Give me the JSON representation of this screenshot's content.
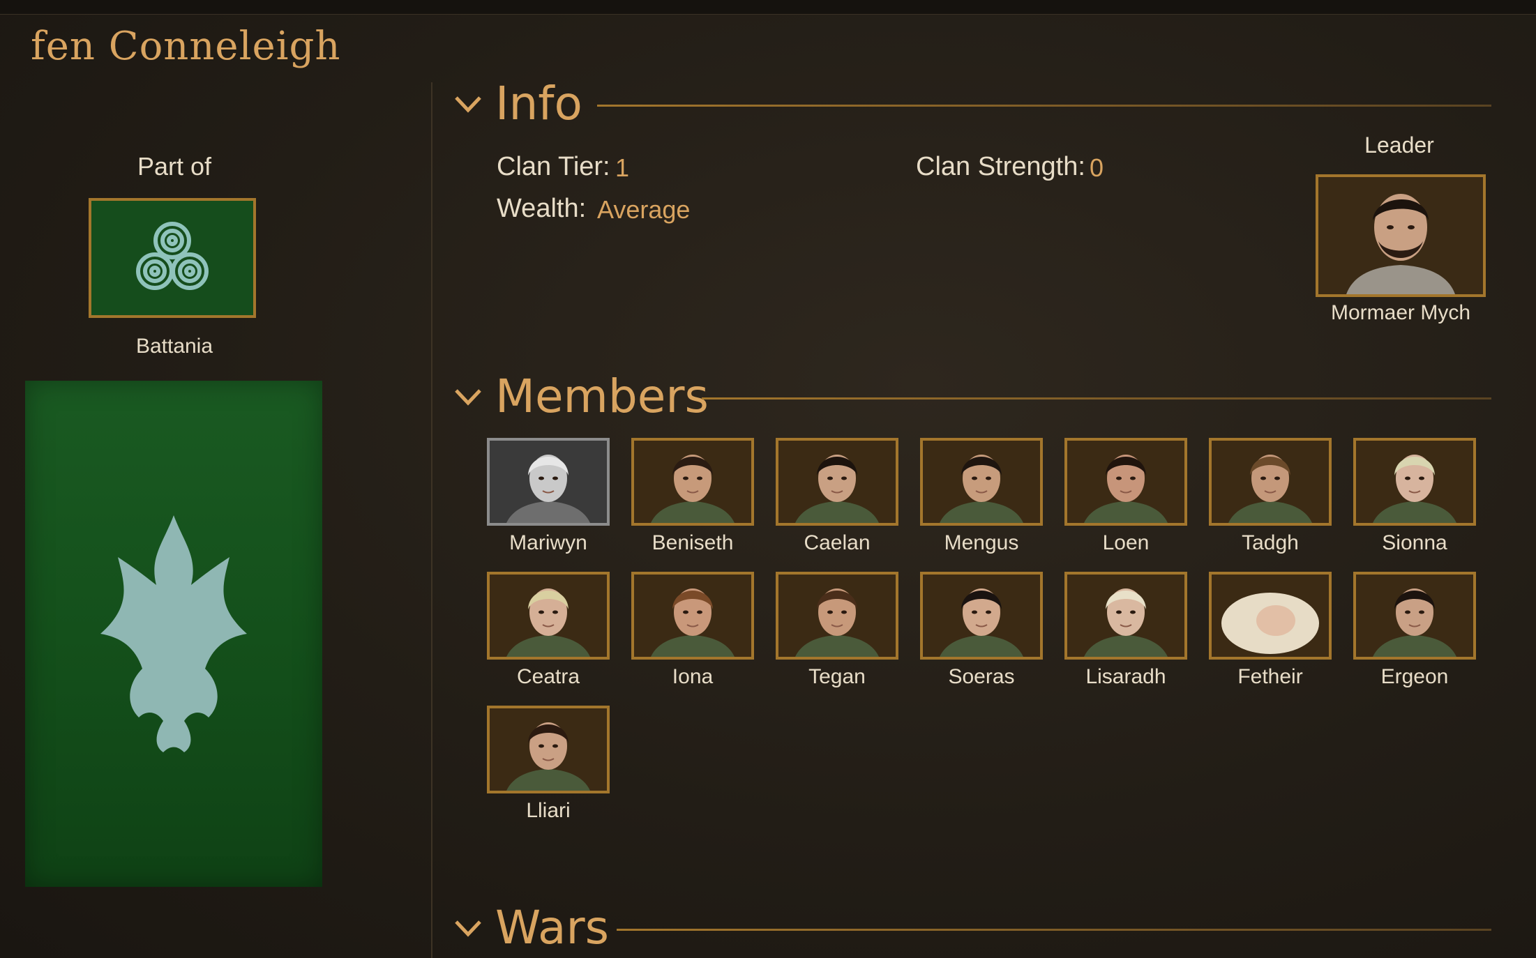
{
  "clan": {
    "name": "fen Conneleigh"
  },
  "kingdom": {
    "part_of_label": "Part of",
    "name": "Battania",
    "banner_color": "#154d1c",
    "symbol_color": "#8fc3bb"
  },
  "clan_banner": {
    "color": "#14501b",
    "symbol_color": "#8fb7b3"
  },
  "colors": {
    "accent": "#d9a460",
    "frame": "#a3762c",
    "text": "#e8ddc8"
  },
  "sections": {
    "info": {
      "title": "Info"
    },
    "members": {
      "title": "Members"
    },
    "wars": {
      "title": "Wars"
    }
  },
  "info": {
    "clan_tier_label": "Clan Tier:",
    "clan_tier_value": "1",
    "clan_strength_label": "Clan Strength:",
    "clan_strength_value": "0",
    "wealth_label": "Wealth:",
    "wealth_value": "Average"
  },
  "leader": {
    "label": "Leader",
    "name": "Mormaer Mych"
  },
  "members": [
    {
      "name": "Mariwyn",
      "skin": "#c9c9c9",
      "hair": "#e6e6e6",
      "grey": true
    },
    {
      "name": "Beniseth",
      "skin": "#c79a7a",
      "hair": "#2a1b12"
    },
    {
      "name": "Caelan",
      "skin": "#c9a083",
      "hair": "#1c130d"
    },
    {
      "name": "Mengus",
      "skin": "#c79c7c",
      "hair": "#1e150f"
    },
    {
      "name": "Loen",
      "skin": "#c7957a",
      "hair": "#20140d"
    },
    {
      "name": "Tadgh",
      "skin": "#c4987a",
      "hair": "#6b4a2a"
    },
    {
      "name": "Sionna",
      "skin": "#d7b49e",
      "hair": "#d8d5b0"
    },
    {
      "name": "Ceatra",
      "skin": "#d5af96",
      "hair": "#d9cfa0"
    },
    {
      "name": "Iona",
      "skin": "#c9987a",
      "hair": "#7a4a28"
    },
    {
      "name": "Tegan",
      "skin": "#c7997a",
      "hair": "#4a2e1a"
    },
    {
      "name": "Soeras",
      "skin": "#d2a98d",
      "hair": "#1a1310"
    },
    {
      "name": "Lisaradh",
      "skin": "#d9b8a0",
      "hair": "#e8e0c8"
    },
    {
      "name": "Fetheir",
      "skin": "#e2bfa6",
      "hair": "#e7dcc6",
      "baby": true
    },
    {
      "name": "Ergeon",
      "skin": "#c9a085",
      "hair": "#1c130e"
    },
    {
      "name": "Lliari",
      "skin": "#caa084",
      "hair": "#2b1a10"
    }
  ]
}
